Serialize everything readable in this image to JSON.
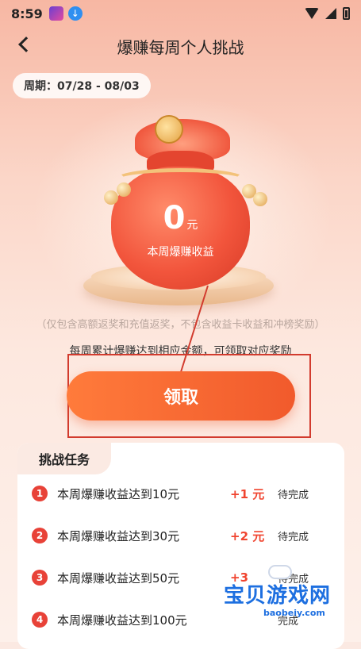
{
  "status_bar": {
    "time": "8:59"
  },
  "header": {
    "title": "爆赚每周个人挑战"
  },
  "period": {
    "text": "周期：07/28 - 08/03"
  },
  "earnings": {
    "amount": "0",
    "unit": "元",
    "label": "本周爆赚收益"
  },
  "note": "（仅包含高额返奖和充值返奖，不包含收益卡收益和冲榜奖励）",
  "rule": "每周累计爆赚达到相应金额，可领取对应奖励",
  "claim_button": "领取",
  "tasks": {
    "tab_label": "挑战任务",
    "items": [
      {
        "num": "1",
        "text": "本周爆赚收益达到10元",
        "reward": "+1 元",
        "status": "待完成"
      },
      {
        "num": "2",
        "text": "本周爆赚收益达到30元",
        "reward": "+2 元",
        "status": "待完成"
      },
      {
        "num": "3",
        "text": "本周爆赚收益达到50元",
        "reward": "+3",
        "status": "待完成"
      },
      {
        "num": "4",
        "text": "本周爆赚收益达到100元",
        "reward": "",
        "status": "完成"
      }
    ]
  },
  "watermark": {
    "title": "宝贝游戏网",
    "url": "baobeiy.com"
  },
  "colors": {
    "accent": "#f15a2c",
    "reward": "#f0442f",
    "annotation": "#d23b2e"
  }
}
